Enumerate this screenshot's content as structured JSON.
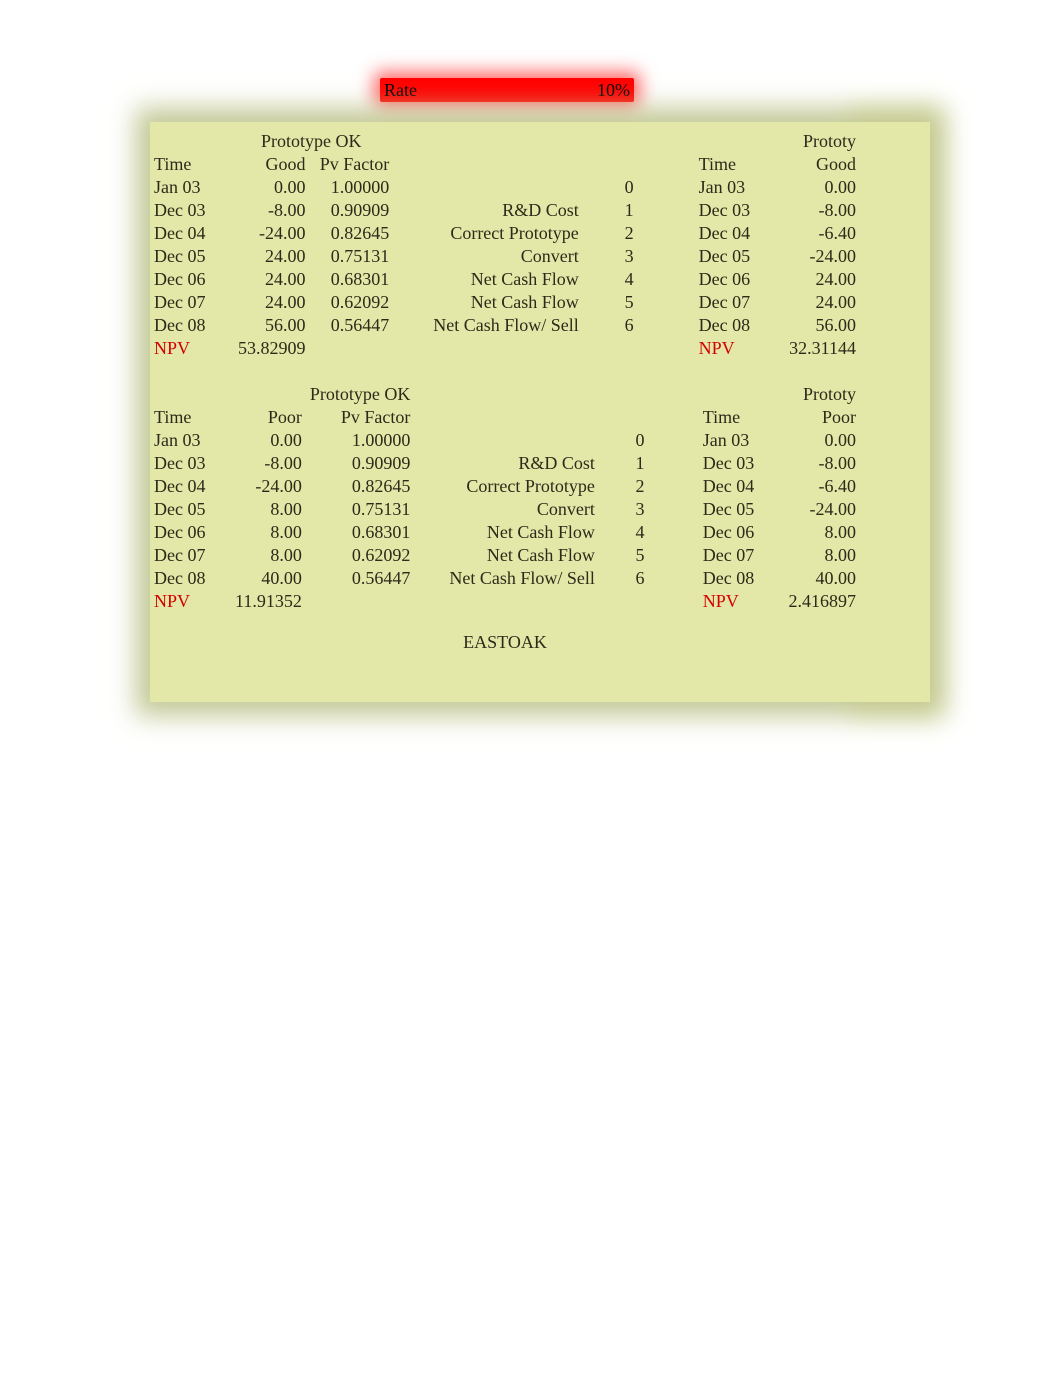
{
  "rate": {
    "label": "Rate",
    "value": "10%"
  },
  "headersA": {
    "proto_left": "Prototype OK",
    "proto_right": "Prototy",
    "time": "Time",
    "scenario_good": "Good",
    "scenario_poor": "Poor",
    "pv": "Pv Factor"
  },
  "labels": [
    "",
    "R&D Cost",
    "Correct Prototype",
    "Convert",
    "Net Cash Flow",
    "Net Cash Flow",
    "Net Cash Flow/ Sell"
  ],
  "idx": [
    "0",
    "1",
    "2",
    "3",
    "4",
    "5",
    "6"
  ],
  "times": [
    "Jan 03",
    "Dec 03",
    "Dec 04",
    "Dec 05",
    "Dec 06",
    "Dec 07",
    "Dec 08"
  ],
  "pv": [
    "1.00000",
    "0.90909",
    "0.82645",
    "0.75131",
    "0.68301",
    "0.62092",
    "0.56447"
  ],
  "block_good": {
    "left_vals": [
      "0.00",
      "-8.00",
      "-24.00",
      "24.00",
      "24.00",
      "24.00",
      "56.00"
    ],
    "left_npv": "53.82909",
    "right_vals": [
      "0.00",
      "-8.00",
      "-6.40",
      "-24.00",
      "24.00",
      "24.00",
      "56.00"
    ],
    "right_npv": "32.31144"
  },
  "block_poor": {
    "left_vals": [
      "0.00",
      "-8.00",
      "-24.00",
      "8.00",
      "8.00",
      "8.00",
      "40.00"
    ],
    "left_npv": "11.91352",
    "right_vals": [
      "0.00",
      "-8.00",
      "-6.40",
      "-24.00",
      "8.00",
      "8.00",
      "40.00"
    ],
    "right_npv": "2.416897"
  },
  "npv_label": "NPV",
  "footer": "EASTOAK"
}
